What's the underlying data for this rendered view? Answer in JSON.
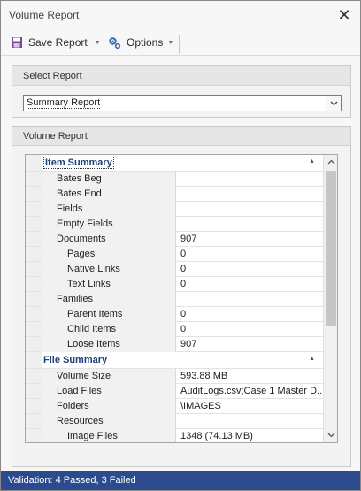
{
  "window": {
    "title": "Volume Report"
  },
  "toolbar": {
    "save_label": "Save Report",
    "options_label": "Options"
  },
  "select_group": {
    "header": "Select Report",
    "selected": "Summary Report"
  },
  "report_group": {
    "header": "Volume Report",
    "sections": [
      {
        "title": "Item Summary",
        "rows": [
          {
            "name": "Bates Beg",
            "value": "",
            "level": 1
          },
          {
            "name": "Bates End",
            "value": "",
            "level": 1
          },
          {
            "name": "Fields",
            "value": "",
            "level": 1
          },
          {
            "name": "Empty Fields",
            "value": "",
            "level": 1
          },
          {
            "name": "Documents",
            "value": "907",
            "level": 1
          },
          {
            "name": "Pages",
            "value": "0",
            "level": 2
          },
          {
            "name": "Native Links",
            "value": "0",
            "level": 2
          },
          {
            "name": "Text Links",
            "value": "0",
            "level": 2
          },
          {
            "name": "Families",
            "value": "",
            "level": 1
          },
          {
            "name": "Parent Items",
            "value": "0",
            "level": 2
          },
          {
            "name": "Child Items",
            "value": "0",
            "level": 2
          },
          {
            "name": "Loose Items",
            "value": "907",
            "level": 2
          }
        ]
      },
      {
        "title": "File Summary",
        "rows": [
          {
            "name": "Volume Size",
            "value": "593.88 MB",
            "level": 1
          },
          {
            "name": "Load Files",
            "value": "AuditLogs.csv;Case 1 Master D...",
            "level": 1
          },
          {
            "name": "Folders",
            "value": "\\IMAGES",
            "level": 1
          },
          {
            "name": "Resources",
            "value": "",
            "level": 1
          },
          {
            "name": "Image Files",
            "value": "1348 (74.13 MB)",
            "level": 2
          }
        ]
      }
    ]
  },
  "status": {
    "text": "Validation: 4 Passed, 3 Failed"
  },
  "colors": {
    "status_bar": "#2c4b8e",
    "section_title": "#1d3f78"
  }
}
